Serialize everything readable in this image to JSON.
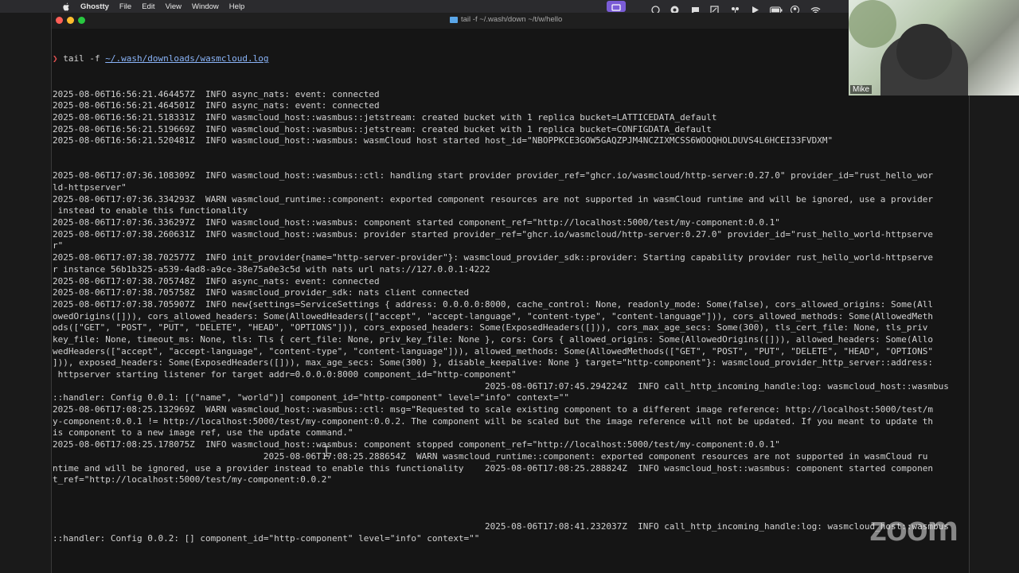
{
  "menubar": {
    "app_name": "Ghostty",
    "items": [
      "File",
      "Edit",
      "View",
      "Window",
      "Help"
    ]
  },
  "status_icons": [
    "focus-mode-icon",
    "record-icon",
    "accessibility-icon",
    "chat-icon",
    "screen-share-icon",
    "flowers-icon",
    "play-icon",
    "battery-icon",
    "user-icon",
    "wifi-icon"
  ],
  "window": {
    "title": "tail -f ~/.wash/down ~/t/w/hello"
  },
  "terminal": {
    "prompt_symbol": "❯",
    "command": "tail -f ",
    "command_path": "~/.wash/downloads/wasmcloud.log",
    "lines": [
      "2025-08-06T16:56:21.464457Z  INFO async_nats: event: connected",
      "2025-08-06T16:56:21.464501Z  INFO async_nats: event: connected",
      "2025-08-06T16:56:21.518331Z  INFO wasmcloud_host::wasmbus::jetstream: created bucket with 1 replica bucket=LATTICEDATA_default",
      "2025-08-06T16:56:21.519669Z  INFO wasmcloud_host::wasmbus::jetstream: created bucket with 1 replica bucket=CONFIGDATA_default",
      "2025-08-06T16:56:21.520481Z  INFO wasmcloud_host::wasmbus: wasmCloud host started host_id=\"NBOPPKCE3GOW5GAQZPJM4NCZIXMCSS6WOOQHOLDUVS4L6HCEI33FVDXM\"",
      "",
      "",
      "2025-08-06T17:07:36.108309Z  INFO wasmcloud_host::wasmbus::ctl: handling start provider provider_ref=\"ghcr.io/wasmcloud/http-server:0.27.0\" provider_id=\"rust_hello_wor",
      "ld-httpserver\"",
      "2025-08-06T17:07:36.334293Z  WARN wasmcloud_runtime::component: exported component resources are not supported in wasmCloud runtime and will be ignored, use a provider",
      " instead to enable this functionality",
      "2025-08-06T17:07:36.336297Z  INFO wasmcloud_host::wasmbus: component started component_ref=\"http://localhost:5000/test/my-component:0.0.1\"",
      "2025-08-06T17:07:38.260631Z  INFO wasmcloud_host::wasmbus: provider started provider_ref=\"ghcr.io/wasmcloud/http-server:0.27.0\" provider_id=\"rust_hello_world-httpserve",
      "r\"",
      "2025-08-06T17:07:38.702577Z  INFO init_provider{name=\"http-server-provider\"}: wasmcloud_provider_sdk::provider: Starting capability provider rust_hello_world-httpserve",
      "r instance 56b1b325-a539-4ad8-a9ce-38e75a0e3c5d with nats url nats://127.0.0.1:4222",
      "2025-08-06T17:07:38.705748Z  INFO async_nats: event: connected",
      "2025-08-06T17:07:38.705758Z  INFO wasmcloud_provider_sdk: nats client connected",
      "2025-08-06T17:07:38.705907Z  INFO new{settings=ServiceSettings { address: 0.0.0.0:8000, cache_control: None, readonly_mode: Some(false), cors_allowed_origins: Some(All",
      "owedOrigins([])), cors_allowed_headers: Some(AllowedHeaders([\"accept\", \"accept-language\", \"content-type\", \"content-language\"])), cors_allowed_methods: Some(AllowedMeth",
      "ods([\"GET\", \"POST\", \"PUT\", \"DELETE\", \"HEAD\", \"OPTIONS\"])), cors_exposed_headers: Some(ExposedHeaders([])), cors_max_age_secs: Some(300), tls_cert_file: None, tls_priv",
      "key_file: None, timeout_ms: None, tls: Tls { cert_file: None, priv_key_file: None }, cors: Cors { allowed_origins: Some(AllowedOrigins([])), allowed_headers: Some(Allo",
      "wedHeaders([\"accept\", \"accept-language\", \"content-type\", \"content-language\"])), allowed_methods: Some(AllowedMethods([\"GET\", \"POST\", \"PUT\", \"DELETE\", \"HEAD\", \"OPTIONS\"",
      "])), exposed_headers: Some(ExposedHeaders([])), max_age_secs: Some(300) }, disable_keepalive: None } target=\"http-component\"}: wasmcloud_provider_http_server::address:",
      " httpserver starting listener for target addr=0.0.0.0:8000 component_id=\"http-component\"",
      "                                                                                  2025-08-06T17:07:45.294224Z  INFO call_http_incoming_handle:log: wasmcloud_host::wasmbus",
      "::handler: Config 0.0.1: [(\"name\", \"world\")] component_id=\"http-component\" level=\"info\" context=\"\"",
      "2025-08-06T17:08:25.132969Z  WARN wasmcloud_host::wasmbus::ctl: msg=\"Requested to scale existing component to a different image reference: http://localhost:5000/test/m",
      "y-component:0.0.1 != http://localhost:5000/test/my-component:0.0.2. The component will be scaled but the image reference will not be updated. If you meant to update th",
      "is component to a new image ref, use the update command.\"",
      "2025-08-06T17:08:25.178075Z  INFO wasmcloud_host::wasmbus: component stopped component_ref=\"http://localhost:5000/test/my-component:0.0.1\"",
      "                                        2025-08-06T17:08:25.288654Z  WARN wasmcloud_runtime::component: exported component resources are not supported in wasmCloud ru",
      "ntime and will be ignored, use a provider instead to enable this functionality    2025-08-06T17:08:25.288824Z  INFO wasmcloud_host::wasmbus: component started componen",
      "t_ref=\"http://localhost:5000/test/my-component:0.0.2\"",
      "",
      "",
      "",
      "                                                                                  2025-08-06T17:08:41.232037Z  INFO call_http_incoming_handle:log: wasmcloud_host::wasmbus",
      "::handler: Config 0.0.2: [] component_id=\"http-component\" level=\"info\" context=\"\""
    ]
  },
  "zoom": {
    "participant_name": "Mike",
    "logo_text": "zoom"
  }
}
